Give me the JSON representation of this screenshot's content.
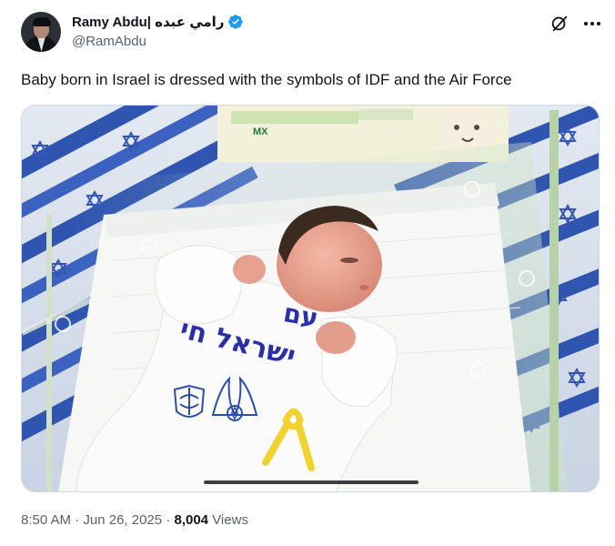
{
  "author": {
    "display_name": "Ramy Abdu| رامي عبده",
    "handle": "@RamAbdu",
    "verified": true,
    "verified_color": "#1d9bf0"
  },
  "tweet": {
    "text": "Baby born in Israel is dressed with the symbols of IDF and the Air Force"
  },
  "media": {
    "onesie_text_line1": "עם",
    "onesie_text_line2": "ישראל חי",
    "onesie_text_color": "#2a2fa8",
    "flag_blue": "#2f55b0",
    "ribbon_color": "#f2d22e"
  },
  "meta": {
    "time": "8:50 AM",
    "separator": "·",
    "date": "Jun 26, 2025",
    "views_count": "8,004",
    "views_label": "Views"
  },
  "icons": {
    "verified": "verified-badge-icon",
    "grok": "grok-icon",
    "more": "more-options-icon"
  }
}
